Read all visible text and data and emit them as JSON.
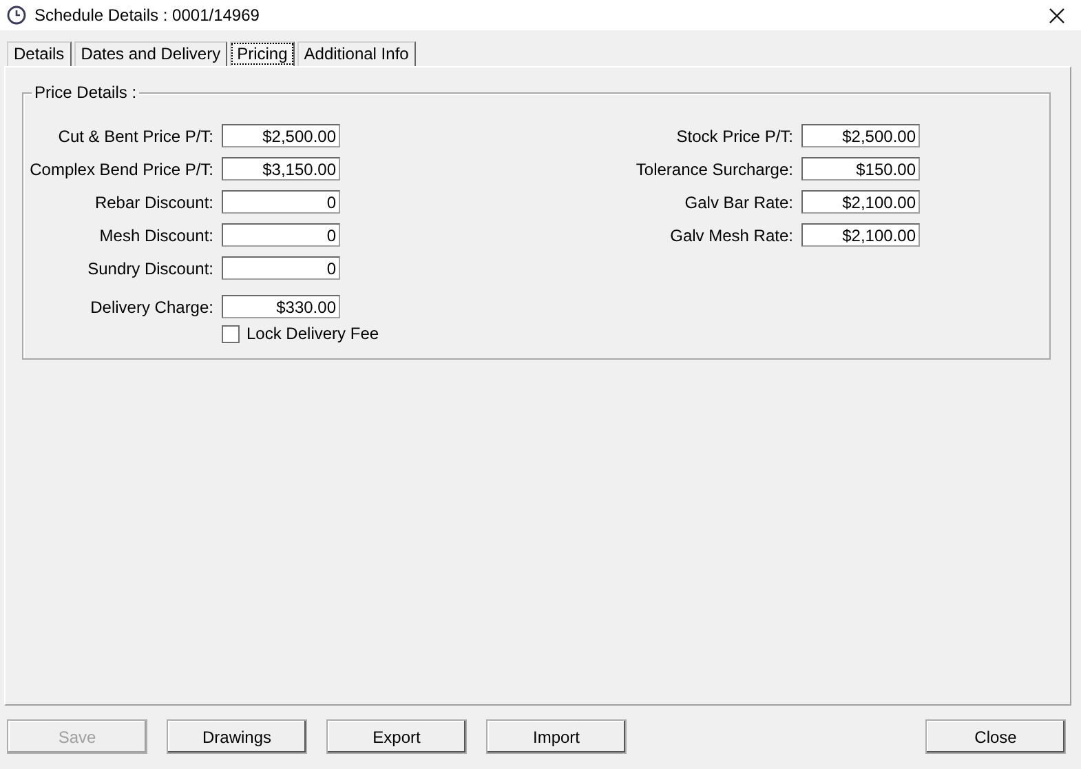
{
  "window": {
    "title": "Schedule Details : 0001/14969"
  },
  "tabs": [
    {
      "label": "Details",
      "selected": false
    },
    {
      "label": "Dates and Delivery",
      "selected": false
    },
    {
      "label": "Pricing",
      "selected": true
    },
    {
      "label": "Additional Info",
      "selected": false
    }
  ],
  "group": {
    "title": "Price Details :",
    "left_fields": [
      {
        "label": "Cut & Bent Price P/T:",
        "value": "$2,500.00"
      },
      {
        "label": "Complex Bend Price P/T:",
        "value": "$3,150.00"
      },
      {
        "label": "Rebar Discount:",
        "value": "0"
      },
      {
        "label": "Mesh Discount:",
        "value": "0"
      },
      {
        "label": "Sundry Discount:",
        "value": "0"
      },
      {
        "label": "Delivery Charge:",
        "value": "$330.00"
      }
    ],
    "checkbox": {
      "label": "Lock Delivery Fee",
      "checked": false
    },
    "right_fields": [
      {
        "label": "Stock Price P/T:",
        "value": "$2,500.00"
      },
      {
        "label": "Tolerance Surcharge:",
        "value": "$150.00"
      },
      {
        "label": "Galv Bar Rate:",
        "value": "$2,100.00"
      },
      {
        "label": "Galv Mesh Rate:",
        "value": "$2,100.00"
      }
    ]
  },
  "buttons_left": [
    {
      "label": "Save",
      "disabled": true
    },
    {
      "label": "Drawings",
      "disabled": false
    },
    {
      "label": "Export",
      "disabled": false
    },
    {
      "label": "Import",
      "disabled": false
    }
  ],
  "buttons_right": [
    {
      "label": "Close",
      "disabled": false
    }
  ]
}
